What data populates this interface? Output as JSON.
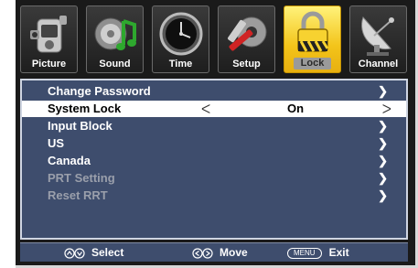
{
  "tabs": [
    {
      "label": "Picture",
      "icon": "camcorder-icon",
      "active": false
    },
    {
      "label": "Sound",
      "icon": "speaker-note-icon",
      "active": false
    },
    {
      "label": "Time",
      "icon": "clock-icon",
      "active": false
    },
    {
      "label": "Setup",
      "icon": "gear-tools-icon",
      "active": false
    },
    {
      "label": "Lock",
      "icon": "padlock-icon",
      "active": true
    },
    {
      "label": "Channel",
      "icon": "satellite-dish-icon",
      "active": false
    }
  ],
  "menu": {
    "items": [
      {
        "label": "Change Password",
        "arrow": "❯"
      },
      {
        "label": "System Lock",
        "left_arrow": "ᐸ",
        "value": "On",
        "right_arrow": "ᐳ"
      },
      {
        "label": "Input Block",
        "arrow": "❯"
      },
      {
        "label": "US",
        "arrow": "❯"
      },
      {
        "label": "Canada",
        "arrow": "❯"
      },
      {
        "label": "PRT Setting",
        "arrow": "❯"
      },
      {
        "label": "Reset RRT",
        "arrow": "❯"
      }
    ]
  },
  "footer": {
    "select_label": "Select",
    "move_label": "Move",
    "menu_key": "MENU",
    "exit_label": "Exit"
  },
  "colors": {
    "panel": "#3e4d6d",
    "active_tab": "#f3c41a",
    "selected_row": "#ffffff"
  }
}
